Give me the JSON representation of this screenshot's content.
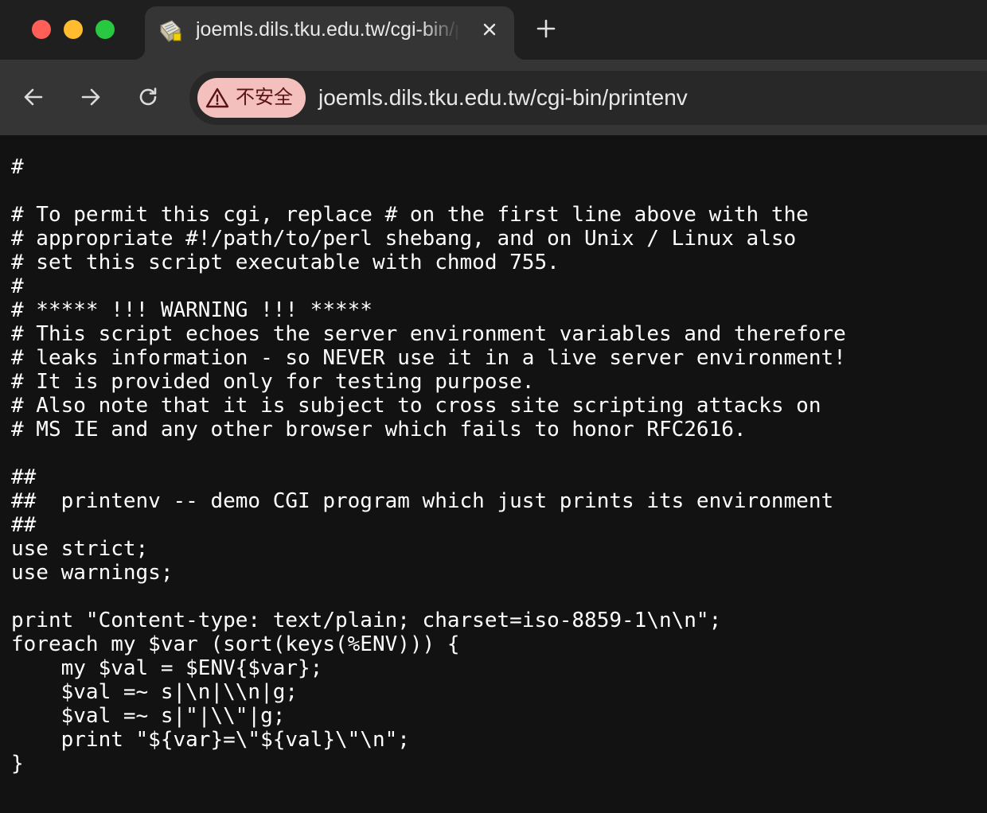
{
  "window": {
    "controls": [
      "close",
      "minimize",
      "zoom"
    ]
  },
  "tab": {
    "title": "joemls.dils.tku.edu.tw/cgi-bin/printenv",
    "favicon": "file-document-icon"
  },
  "toolbar": {
    "security_label": "不安全",
    "url": "joemls.dils.tku.edu.tw/cgi-bin/printenv",
    "colors": {
      "security_chip_bg": "#f3c0be",
      "security_chip_text": "#5a1414"
    }
  },
  "page": {
    "lines": [
      "#",
      "",
      "# To permit this cgi, replace # on the first line above with the",
      "# appropriate #!/path/to/perl shebang, and on Unix / Linux also",
      "# set this script executable with chmod 755.",
      "#",
      "# ***** !!! WARNING !!! *****",
      "# This script echoes the server environment variables and therefore",
      "# leaks information - so NEVER use it in a live server environment!",
      "# It is provided only for testing purpose.",
      "# Also note that it is subject to cross site scripting attacks on",
      "# MS IE and any other browser which fails to honor RFC2616.",
      "",
      "##",
      "##  printenv -- demo CGI program which just prints its environment",
      "##",
      "use strict;",
      "use warnings;",
      "",
      "print \"Content-type: text/plain; charset=iso-8859-1\\n\\n\";",
      "foreach my $var (sort(keys(%ENV))) {",
      "    my $val = $ENV{$var};",
      "    $val =~ s|\\n|\\\\n|g;",
      "    $val =~ s|\"|\\\\\"|g;",
      "    print \"${var}=\\\"${val}\\\"\\n\";",
      "}"
    ]
  }
}
